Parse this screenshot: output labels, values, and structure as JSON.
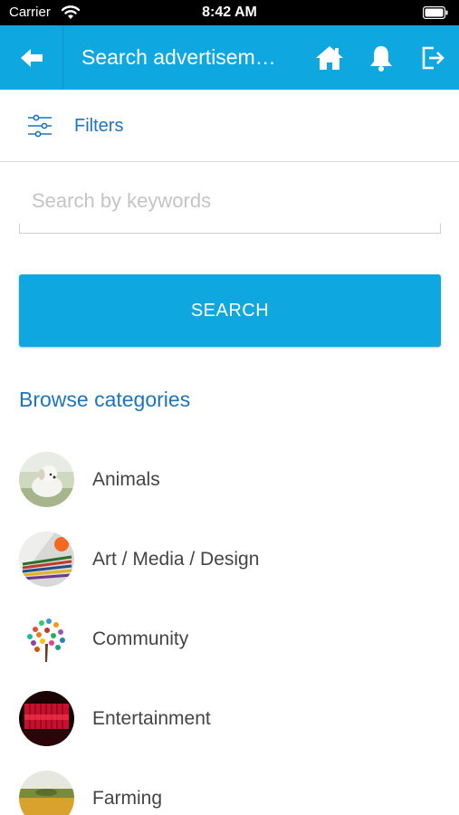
{
  "status_bar": {
    "carrier": "Carrier",
    "time": "8:42 AM"
  },
  "app_bar": {
    "title": "Search advertisem…",
    "icons": [
      "back-arrow-icon",
      "home-icon",
      "bell-icon",
      "logout-icon"
    ],
    "color": "#0ea7e0"
  },
  "filters": {
    "label": "Filters",
    "icon": "sliders-icon"
  },
  "search": {
    "value": "",
    "placeholder": "Search by keywords",
    "button_label": "SEARCH"
  },
  "browse": {
    "heading": "Browse categories",
    "categories": [
      {
        "label": "Animals",
        "icon": "animals-photo"
      },
      {
        "label": "Art / Media / Design",
        "icon": "art-photo"
      },
      {
        "label": "Community",
        "icon": "community-tree-photo"
      },
      {
        "label": "Entertainment",
        "icon": "entertainment-stage-photo"
      },
      {
        "label": "Farming",
        "icon": "farming-field-photo"
      }
    ]
  },
  "colors": {
    "accent": "#0ea7e0",
    "link": "#1e73be"
  }
}
